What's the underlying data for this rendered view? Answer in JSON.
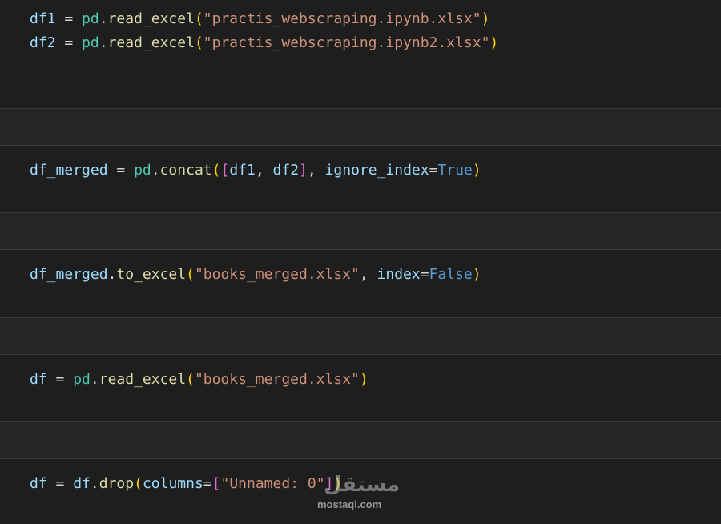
{
  "cells": [
    {
      "lines": [
        [
          {
            "t": "df1",
            "c": "var"
          },
          {
            "t": " = ",
            "c": "op"
          },
          {
            "t": "pd",
            "c": "mod"
          },
          {
            "t": ".",
            "c": "op"
          },
          {
            "t": "read_excel",
            "c": "fn"
          },
          {
            "t": "(",
            "c": "p1"
          },
          {
            "t": "\"practis_webscraping.ipynb.xlsx\"",
            "c": "str"
          },
          {
            "t": ")",
            "c": "p1"
          }
        ],
        [
          {
            "t": "df2",
            "c": "var"
          },
          {
            "t": " = ",
            "c": "op"
          },
          {
            "t": "pd",
            "c": "mod"
          },
          {
            "t": ".",
            "c": "op"
          },
          {
            "t": "read_excel",
            "c": "fn"
          },
          {
            "t": "(",
            "c": "p1"
          },
          {
            "t": "\"practis_webscraping.ipynb2.xlsx\"",
            "c": "str"
          },
          {
            "t": ")",
            "c": "p1"
          }
        ]
      ]
    },
    {
      "lines": [
        [
          {
            "t": "df_merged",
            "c": "var"
          },
          {
            "t": " = ",
            "c": "op"
          },
          {
            "t": "pd",
            "c": "mod"
          },
          {
            "t": ".",
            "c": "op"
          },
          {
            "t": "concat",
            "c": "fn"
          },
          {
            "t": "(",
            "c": "p1"
          },
          {
            "t": "[",
            "c": "p2"
          },
          {
            "t": "df1",
            "c": "var"
          },
          {
            "t": ", ",
            "c": "op"
          },
          {
            "t": "df2",
            "c": "var"
          },
          {
            "t": "]",
            "c": "p2"
          },
          {
            "t": ", ",
            "c": "op"
          },
          {
            "t": "ignore_index",
            "c": "var"
          },
          {
            "t": "=",
            "c": "op"
          },
          {
            "t": "True",
            "c": "kw"
          },
          {
            "t": ")",
            "c": "p1"
          }
        ]
      ]
    },
    {
      "lines": [
        [
          {
            "t": "df_merged",
            "c": "var"
          },
          {
            "t": ".",
            "c": "op"
          },
          {
            "t": "to_excel",
            "c": "fn"
          },
          {
            "t": "(",
            "c": "p1"
          },
          {
            "t": "\"books_merged.xlsx\"",
            "c": "str"
          },
          {
            "t": ", ",
            "c": "op"
          },
          {
            "t": "index",
            "c": "var"
          },
          {
            "t": "=",
            "c": "op"
          },
          {
            "t": "False",
            "c": "kw"
          },
          {
            "t": ")",
            "c": "p1"
          }
        ]
      ]
    },
    {
      "lines": [
        [
          {
            "t": "df",
            "c": "var"
          },
          {
            "t": " = ",
            "c": "op"
          },
          {
            "t": "pd",
            "c": "mod"
          },
          {
            "t": ".",
            "c": "op"
          },
          {
            "t": "read_excel",
            "c": "fn"
          },
          {
            "t": "(",
            "c": "p1"
          },
          {
            "t": "\"books_merged.xlsx\"",
            "c": "str"
          },
          {
            "t": ")",
            "c": "p1"
          }
        ]
      ]
    },
    {
      "lines": [
        [
          {
            "t": "df",
            "c": "var"
          },
          {
            "t": " = ",
            "c": "op"
          },
          {
            "t": "df",
            "c": "var"
          },
          {
            "t": ".",
            "c": "op"
          },
          {
            "t": "drop",
            "c": "fn"
          },
          {
            "t": "(",
            "c": "p1"
          },
          {
            "t": "columns",
            "c": "var"
          },
          {
            "t": "=",
            "c": "op"
          },
          {
            "t": "[",
            "c": "p2"
          },
          {
            "t": "\"Unnamed: 0\"",
            "c": "str"
          },
          {
            "t": "]",
            "c": "p2"
          },
          {
            "t": ")",
            "c": "p1"
          }
        ]
      ]
    }
  ],
  "watermark": {
    "arabic": "مستقل",
    "latin": "mostaql.com"
  },
  "colors": {
    "background": "#1e1e1e",
    "separator": "#262626",
    "variable": "#9cdcfe",
    "module": "#4ec9b0",
    "function": "#dcdcaa",
    "string": "#ce9178",
    "keyword": "#569cd6",
    "bracket_outer": "#ffd700",
    "bracket_inner": "#da70d6"
  }
}
